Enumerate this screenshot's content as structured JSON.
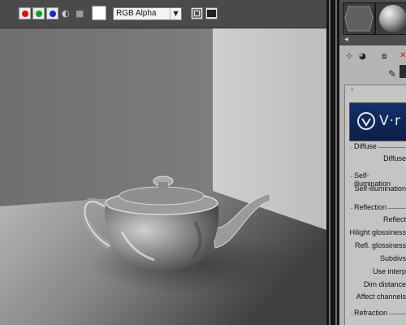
{
  "render_window": {
    "toolbar": {
      "channel_select": "RGB Alpha",
      "channels": [
        {
          "name": "red",
          "color": "#d21313"
        },
        {
          "name": "green",
          "color": "#12a022"
        },
        {
          "name": "blue",
          "color": "#1429cc"
        }
      ]
    }
  },
  "material_editor": {
    "rollout_collapse": "-",
    "logo_text": "V·r",
    "groups": {
      "diffuse": {
        "title": "Diffuse",
        "props": [
          "Diffuse"
        ]
      },
      "self_illumination": {
        "title": "Self-illumination",
        "props": [
          "Self-illumination"
        ]
      },
      "reflection": {
        "title": "Reflection",
        "props": [
          "Reflect",
          "Hilight glossiness",
          "Refl. glossiness",
          "Subdivs",
          "Use interp",
          "Dim distance",
          "Affect channels"
        ]
      },
      "refraction": {
        "title": "Refraction"
      }
    }
  }
}
